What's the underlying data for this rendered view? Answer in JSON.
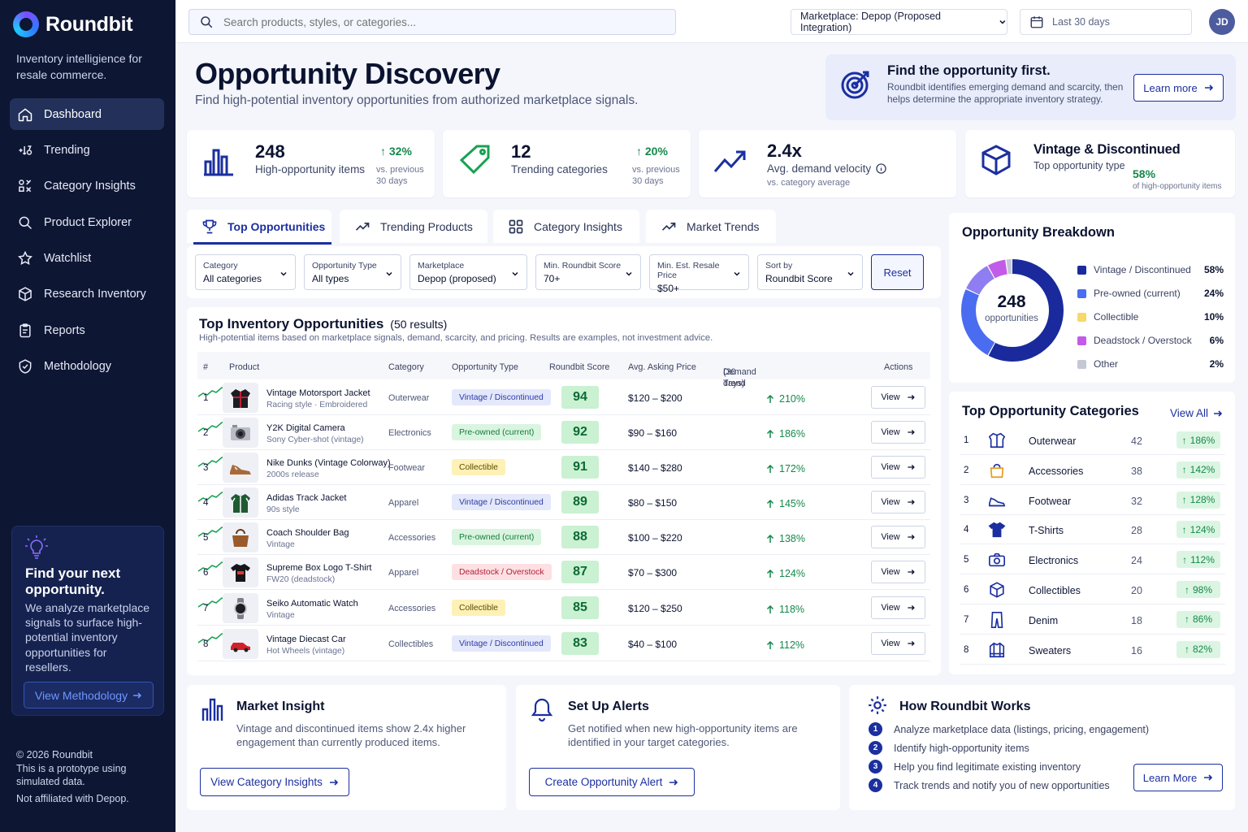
{
  "brand": {
    "name": "Roundbit",
    "tagline": "Inventory intelligience for resale commerce."
  },
  "nav": [
    {
      "label": "Dashboard",
      "icon": "home-icon",
      "active": true
    },
    {
      "label": "Trending",
      "icon": "trending-sort-icon"
    },
    {
      "label": "Category Insights",
      "icon": "category-grid-icon"
    },
    {
      "label": "Product Explorer",
      "icon": "search-icon"
    },
    {
      "label": "Watchlist",
      "icon": "star-icon"
    },
    {
      "label": "Research Inventory",
      "icon": "box-icon"
    },
    {
      "label": "Reports",
      "icon": "clipboard-icon"
    },
    {
      "label": "Methodology",
      "icon": "shield-check-icon"
    }
  ],
  "promo": {
    "title": "Find your next opportunity.",
    "text": "We analyze marketplace signals to surface high-potential inventory opportunities for resellers.",
    "button": "View Methodology"
  },
  "footer": {
    "copyright": "© 2026 Roundbit",
    "note": "This is a prototype using simulated data.",
    "disclaimer": "Not affiliated with Depop."
  },
  "topbar": {
    "search_placeholder": "Search products, styles, or categories...",
    "marketplace": "Marketplace: Depop (Proposed Integration)",
    "date_range": "Last 30 days",
    "avatar": "JD"
  },
  "page": {
    "title": "Opportunity Discovery",
    "subtitle": "Find high-potential inventory opportunities from authorized marketplace signals."
  },
  "hero": {
    "title": "Find the opportunity first.",
    "text": "Roundbit identifies emerging demand and scarcity, then helps determine the appropriate inventory strategy.",
    "button": "Learn more"
  },
  "kpis": [
    {
      "value": "248",
      "label": "High-opportunity items",
      "change": "32%",
      "vs": "vs. previous 30 days"
    },
    {
      "value": "12",
      "label": "Trending categories",
      "change": "20%",
      "vs": "vs. previous 30 days"
    },
    {
      "value": "2.4x",
      "label": "Avg. demand velocity",
      "vs": "vs. category average"
    },
    {
      "value": "Vintage & Discontinued",
      "label": "Top opportunity type",
      "change": "58%",
      "vs": "of high-opportunity items"
    }
  ],
  "tabs": [
    "Top Opportunities",
    "Trending Products",
    "Category Insights",
    "Market Trends"
  ],
  "filters": [
    {
      "label": "Category",
      "value": "All categories"
    },
    {
      "label": "Opportunity Type",
      "value": "All types"
    },
    {
      "label": "Marketplace",
      "value": "Depop (proposed)"
    },
    {
      "label": "Min. Roundbit Score",
      "value": "70+"
    },
    {
      "label": "Min. Est. Resale Price",
      "value": "$50+"
    },
    {
      "label": "Sort by",
      "value": "Roundbit Score"
    }
  ],
  "reset": "Reset",
  "table": {
    "title": "Top Inventory Opportunities",
    "count": "(50 results)",
    "subtitle": "High-potential items based on marketplace signals, demand, scarcity, and pricing. Results are examples, not investment advice.",
    "headers": {
      "rank": "#",
      "product": "Product",
      "category": "Category",
      "type": "Opportunity Type",
      "score": "Roundbit Score",
      "price": "Avg. Asking Price",
      "trend": "Demand Trend",
      "trend2": "(30 days)",
      "actions": "Actions"
    },
    "view_label": "View",
    "rows": [
      {
        "rank": "1",
        "name": "Vintage Motorsport Jacket",
        "sub": "Racing style · Embroidered",
        "category": "Outerwear",
        "type": "Vintage / Discontinued",
        "score": "94",
        "price": "$120 – $200",
        "trend": "210%",
        "icon": "jacket-icon"
      },
      {
        "rank": "2",
        "name": "Y2K Digital Camera",
        "sub": "Sony Cyber-shot (vintage)",
        "category": "Electronics",
        "type": "Pre-owned (current)",
        "score": "92",
        "price": "$90 – $160",
        "trend": "186%",
        "icon": "camera-icon"
      },
      {
        "rank": "3",
        "name": "Nike Dunks (Vintage Colorway)",
        "sub": "2000s release",
        "category": "Footwear",
        "type": "Collectible",
        "score": "91",
        "price": "$140 – $280",
        "trend": "172%",
        "icon": "sneaker-icon"
      },
      {
        "rank": "4",
        "name": "Adidas Track Jacket",
        "sub": "90s style",
        "category": "Apparel",
        "type": "Vintage / Discontinued",
        "score": "89",
        "price": "$80 – $150",
        "trend": "145%",
        "icon": "track-jacket-icon"
      },
      {
        "rank": "5",
        "name": "Coach Shoulder Bag",
        "sub": "Vintage",
        "category": "Accessories",
        "type": "Pre-owned (current)",
        "score": "88",
        "price": "$100 – $220",
        "trend": "138%",
        "icon": "bag-icon"
      },
      {
        "rank": "6",
        "name": "Supreme Box Logo T-Shirt",
        "sub": "FW20 (deadstock)",
        "category": "Apparel",
        "type": "Deadstock / Overstock",
        "score": "87",
        "price": "$70 – $300",
        "trend": "124%",
        "icon": "tshirt-icon"
      },
      {
        "rank": "7",
        "name": "Seiko Automatic Watch",
        "sub": "Vintage",
        "category": "Accessories",
        "type": "Collectible",
        "score": "85",
        "price": "$120 – $250",
        "trend": "118%",
        "icon": "watch-icon"
      },
      {
        "rank": "8",
        "name": "Vintage Diecast Car",
        "sub": "Hot Wheels (vintage)",
        "category": "Collectibles",
        "type": "Vintage / Discontinued",
        "score": "83",
        "price": "$40 – $100",
        "trend": "112%",
        "icon": "car-icon"
      }
    ]
  },
  "breakdown": {
    "title": "Opportunity Breakdown",
    "total": "248",
    "total_label": "opportunities",
    "segments": [
      {
        "name": "Vintage / Discontinued",
        "value": "58%",
        "pct": 58,
        "color": "#1a2a9c"
      },
      {
        "name": "Pre-owned (current)",
        "value": "24%",
        "pct": 24,
        "color": "#4a6cf0"
      },
      {
        "name": "Collectible",
        "value": "10%",
        "pct": 10,
        "color": "#f5d969"
      },
      {
        "name": "Deadstock / Overstock",
        "value": "6%",
        "pct": 6,
        "color": "#c25bea"
      },
      {
        "name": "Other",
        "value": "2%",
        "pct": 2,
        "color": "#c3c7d6"
      }
    ],
    "donut_colors": [
      "#1a2a9c",
      "#4a6cf0",
      "#8f7df2",
      "#c25bea",
      "#c3c7d6"
    ]
  },
  "categories": {
    "title": "Top Opportunity Categories",
    "view_all": "View All",
    "rows": [
      {
        "rank": "1",
        "name": "Outerwear",
        "count": "42",
        "change": "186%",
        "icon": "jacket-outline-icon"
      },
      {
        "rank": "2",
        "name": "Accessories",
        "count": "38",
        "change": "142%",
        "icon": "bag-outline-icon"
      },
      {
        "rank": "3",
        "name": "Footwear",
        "count": "32",
        "change": "128%",
        "icon": "sneaker-outline-icon"
      },
      {
        "rank": "4",
        "name": "T-Shirts",
        "count": "28",
        "change": "124%",
        "icon": "tshirt-outline-icon"
      },
      {
        "rank": "5",
        "name": "Electronics",
        "count": "24",
        "change": "112%",
        "icon": "camera-outline-icon"
      },
      {
        "rank": "6",
        "name": "Collectibles",
        "count": "20",
        "change": "98%",
        "icon": "cube-outline-icon"
      },
      {
        "rank": "7",
        "name": "Denim",
        "count": "18",
        "change": "86%",
        "icon": "jeans-outline-icon"
      },
      {
        "rank": "8",
        "name": "Sweaters",
        "count": "16",
        "change": "82%",
        "icon": "sweater-outline-icon"
      }
    ]
  },
  "insight": {
    "title": "Market Insight",
    "text": "Vintage and discontinued items show 2.4x higher engagement than currently produced items.",
    "button": "View Category Insights"
  },
  "alerts": {
    "title": "Set Up Alerts",
    "text": "Get notified when new high-opportunity items are identified in your target categories.",
    "button": "Create Opportunity Alert"
  },
  "how": {
    "title": "How Roundbit Works",
    "steps": [
      "Analyze marketplace data (listings, pricing, engagement)",
      "Identify high-opportunity items",
      "Help you find legitimate existing inventory",
      "Track trends and notify you of new opportunities"
    ],
    "button": "Learn More"
  }
}
